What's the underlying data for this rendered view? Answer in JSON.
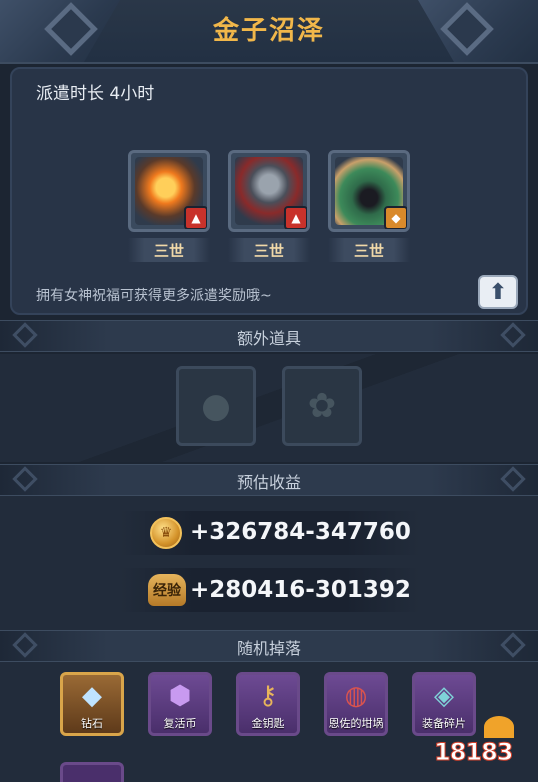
{
  "header": {
    "title": "金子沼泽"
  },
  "dispatch": {
    "duration": "派遣时长 4小时",
    "heroes": [
      {
        "rank": "三世",
        "element": "fire-icon",
        "badge_color": "#c8322b"
      },
      {
        "rank": "三世",
        "element": "fire-icon",
        "badge_color": "#c8322b"
      },
      {
        "rank": "三世",
        "element": "earth-icon",
        "badge_color": "#d98a2b"
      }
    ],
    "blessing_hint": "拥有女神祝福可获得更多派遣奖励哦~",
    "up_button_icon": "arrow-up-icon"
  },
  "extra_items": {
    "title": "额外道具",
    "slots": [
      {
        "icon": "locked-rune-icon"
      },
      {
        "icon": "locked-leaf-icon"
      }
    ]
  },
  "estimated_income": {
    "title": "预估收益",
    "gold": {
      "icon": "gold-coin-icon",
      "value": "+326784-347760"
    },
    "exp": {
      "icon": "exp-icon",
      "icon_text": "经验",
      "value": "+280416-301392"
    }
  },
  "random_drops": {
    "title": "随机掉落",
    "items": [
      {
        "label": "钻石",
        "icon": "diamond-icon",
        "frame": "gold"
      },
      {
        "label": "复活币",
        "icon": "revive-coin-icon",
        "frame": "purple"
      },
      {
        "label": "金钥匙",
        "icon": "gold-key-icon",
        "frame": "purple"
      },
      {
        "label": "恩佐的坩埚",
        "icon": "crucible-icon",
        "frame": "purple"
      },
      {
        "label": "装备碎片",
        "icon": "equipment-shard-icon",
        "frame": "purple"
      }
    ]
  },
  "watermark": {
    "text": "18183"
  }
}
